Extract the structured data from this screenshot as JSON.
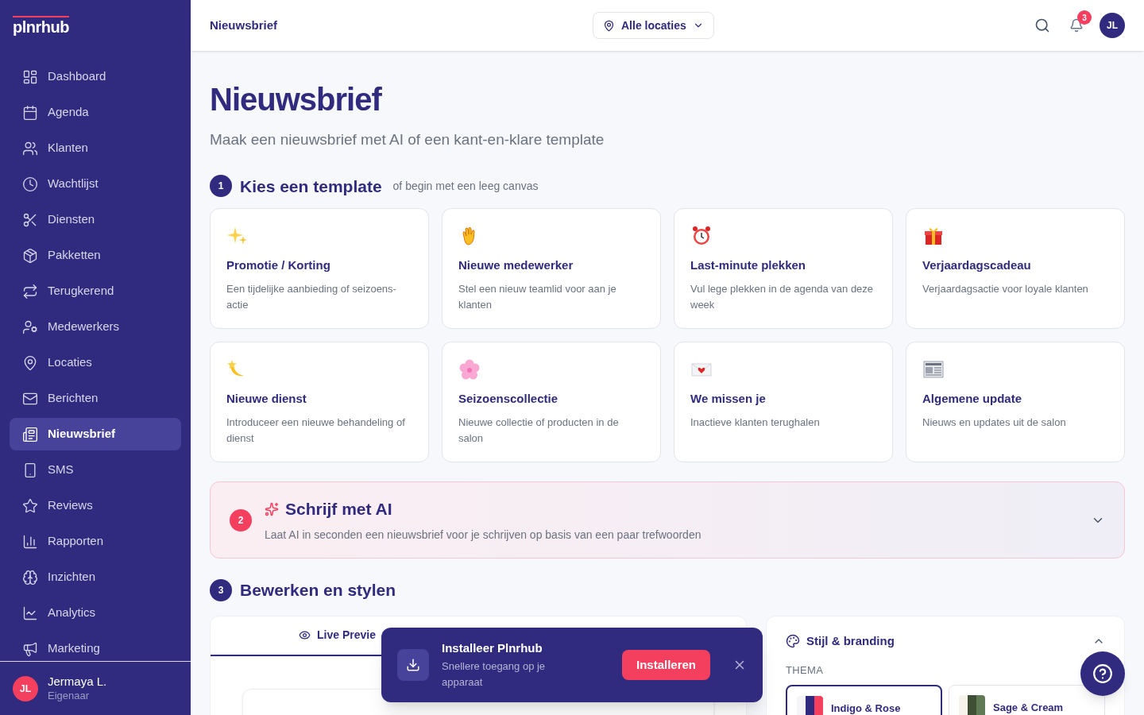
{
  "logo": "plnrhub",
  "sidebar": {
    "items": [
      {
        "label": "Dashboard",
        "selected": false
      },
      {
        "label": "Agenda",
        "selected": false
      },
      {
        "label": "Klanten",
        "selected": false
      },
      {
        "label": "Wachtlijst",
        "selected": false
      },
      {
        "label": "Diensten",
        "selected": false
      },
      {
        "label": "Pakketten",
        "selected": false
      },
      {
        "label": "Terugkerend",
        "selected": false
      },
      {
        "label": "Medewerkers",
        "selected": false
      },
      {
        "label": "Locaties",
        "selected": false
      },
      {
        "label": "Berichten",
        "selected": false
      },
      {
        "label": "Nieuwsbrief",
        "selected": true
      },
      {
        "label": "SMS",
        "selected": false
      },
      {
        "label": "Reviews",
        "selected": false
      },
      {
        "label": "Rapporten",
        "selected": false
      },
      {
        "label": "Inzichten",
        "selected": false
      },
      {
        "label": "Analytics",
        "selected": false
      },
      {
        "label": "Marketing",
        "selected": false
      }
    ],
    "user": {
      "initials": "JL",
      "name": "Jermaya L.",
      "role": "Eigenaar"
    }
  },
  "header": {
    "title": "Nieuwsbrief",
    "location": "Alle locaties",
    "notifications": "3",
    "avatar": "JL"
  },
  "page": {
    "title": "Nieuwsbrief",
    "subtitle": "Maak een nieuwsbrief met AI of een kant-en-klare template"
  },
  "step1": {
    "number": "1",
    "title": "Kies een template",
    "hint": "of begin met een leeg canvas",
    "templates": [
      {
        "title": "Promotie / Korting",
        "description": "Een tijdelijke aanbieding of seizoens-actie"
      },
      {
        "title": "Nieuwe medewerker",
        "description": "Stel een nieuw teamlid voor aan je klanten"
      },
      {
        "title": "Last-minute plekken",
        "description": "Vul lege plekken in de agenda van deze week"
      },
      {
        "title": "Verjaardagscadeau",
        "description": "Verjaardagsactie voor loyale klanten"
      },
      {
        "title": "Nieuwe dienst",
        "description": "Introduceer een nieuwe behandeling of dienst"
      },
      {
        "title": "Seizoenscollectie",
        "description": "Nieuwe collectie of producten in de salon"
      },
      {
        "title": "We missen je",
        "description": "Inactieve klanten terughalen"
      },
      {
        "title": "Algemene update",
        "description": "Nieuws en updates uit de salon"
      }
    ]
  },
  "step2": {
    "number": "2",
    "title": "Schrijf met AI",
    "description": "Laat AI in seconden een nieuwsbrief voor je schrijven op basis van een paar trefwoorden",
    "expanded": false
  },
  "step3": {
    "number": "3",
    "title": "Bewerken en stylen",
    "preview_tab": {
      "label": "Live Previe",
      "selected": true
    },
    "style_panel": {
      "title": "Stijl & branding",
      "expanded": true,
      "theme_label": "THEMA",
      "themes": [
        {
          "name": "Indigo & Rose",
          "selected": true
        },
        {
          "name": "Sage & Cream",
          "selected": false
        }
      ]
    }
  },
  "install_toast": {
    "title": "Installeer Plnrhub",
    "description": "Snellere toegang op je apparaat",
    "button": "Installeren"
  }
}
